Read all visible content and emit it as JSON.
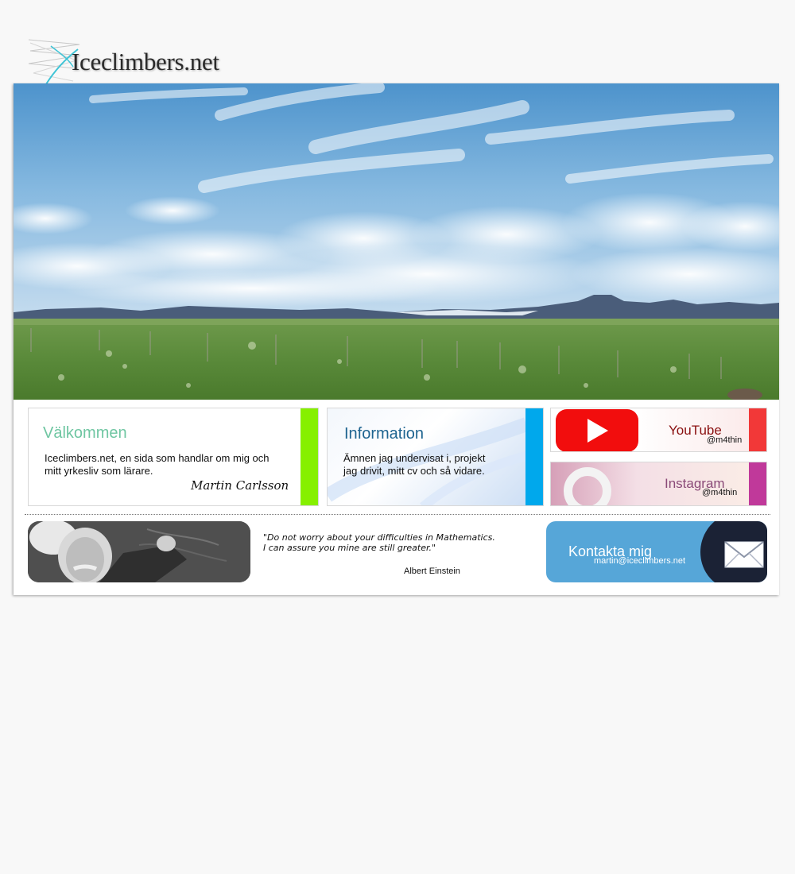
{
  "logo": {
    "text": "Iceclimbers.net"
  },
  "cards": {
    "welcome": {
      "title": "Välkommen",
      "text": "Iceclimbers.net, en sida som handlar om mig och\nmitt yrkesliv som lärare.",
      "signature": "Martin Carlsson",
      "accent": "#86f000"
    },
    "info": {
      "title": "Information",
      "text": "Ämnen jag undervisat i, projekt\njag drivit, mitt cv och så vidare.",
      "accent": "#00a8ec"
    }
  },
  "social": {
    "youtube": {
      "name": "YouTube",
      "handle": "@m4thin",
      "accent": "#f23838"
    },
    "instagram": {
      "name": "Instagram",
      "handle": "@m4thin",
      "accent": "#c0399a"
    }
  },
  "quote": {
    "text": "\"Do not worry about your difficulties in Mathematics.\nI can assure you mine are still greater.\"",
    "author": "Albert Einstein"
  },
  "contact": {
    "title": "Kontakta mig",
    "email": "martin@iceclimbers.net"
  }
}
